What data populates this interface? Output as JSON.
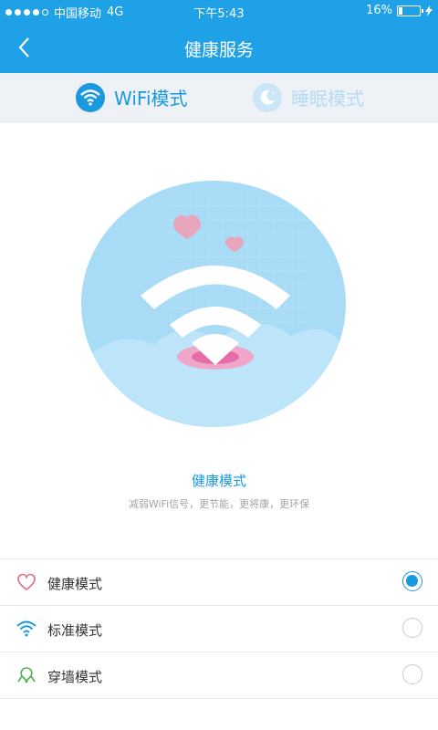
{
  "status_bar": {
    "carrier": "中国移动",
    "network": "4G",
    "time": "下午5:43",
    "battery": "16%",
    "battery_level": 0.16
  },
  "header": {
    "title": "健康服务"
  },
  "tabs": [
    {
      "label": "WiFi模式",
      "active": true,
      "icon": "wifi-icon"
    },
    {
      "label": "睡眠模式",
      "active": false,
      "icon": "moon-icon"
    }
  ],
  "mode": {
    "title": "健康模式",
    "description": "减弱WiFi信号，更节能，更将康，更环保"
  },
  "options": [
    {
      "label": "健康模式",
      "icon": "heart-icon",
      "selected": true
    },
    {
      "label": "标准模式",
      "icon": "wifi-icon",
      "selected": false
    },
    {
      "label": "穿墙模式",
      "icon": "wall-icon",
      "selected": false
    }
  ],
  "colors": {
    "accent": "#1ea1e6",
    "tab_inactive": "#b6dcf3",
    "heart": "#e46c7e"
  }
}
